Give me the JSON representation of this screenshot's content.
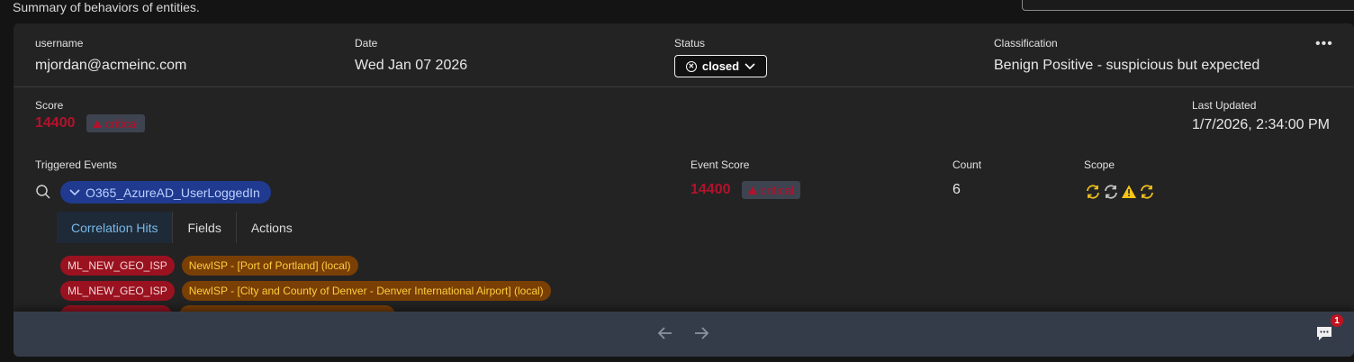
{
  "page": {
    "subtitle": "Summary of behaviors of entities."
  },
  "header": {
    "username_label": "username",
    "username": "mjordan@acmeinc.com",
    "date_label": "Date",
    "date": "Wed Jan 07 2026",
    "status_label": "Status",
    "status": "closed",
    "classification_label": "Classification",
    "classification": "Benign Positive - suspicious but expected",
    "more_icon": "more-horizontal-icon"
  },
  "score": {
    "label": "Score",
    "value": "14400",
    "severity": "critical",
    "last_updated_label": "Last Updated",
    "last_updated": "1/7/2026, 2:34:00 PM"
  },
  "events": {
    "triggered_label": "Triggered Events",
    "event_score_label": "Event Score",
    "count_label": "Count",
    "scope_label": "Scope",
    "items": [
      {
        "name": "O365_AzureAD_UserLoggedIn",
        "score": "14400",
        "severity": "critical",
        "count": "6",
        "scope_icons": [
          "refresh-yellow-icon",
          "refresh-gray-icon",
          "warning-icon",
          "refresh-yellow-icon"
        ]
      }
    ]
  },
  "tabs": [
    "Correlation Hits",
    "Fields",
    "Actions"
  ],
  "hits": [
    {
      "rule": "ML_NEW_GEO_ISP",
      "detail": "NewISP - [Port of Portland] (local)"
    },
    {
      "rule": "ML_NEW_GEO_ISP",
      "detail": "NewISP - [City and County of Denver - Denver International Airport] (local)"
    }
  ],
  "footer": {
    "prev_icon": "arrow-left-icon",
    "next_icon": "arrow-right-icon",
    "chat_badge": "1"
  },
  "colors": {
    "critical": "#b3122b",
    "accent": "#79b8e8",
    "chip_blue": "#1f3a8f"
  }
}
